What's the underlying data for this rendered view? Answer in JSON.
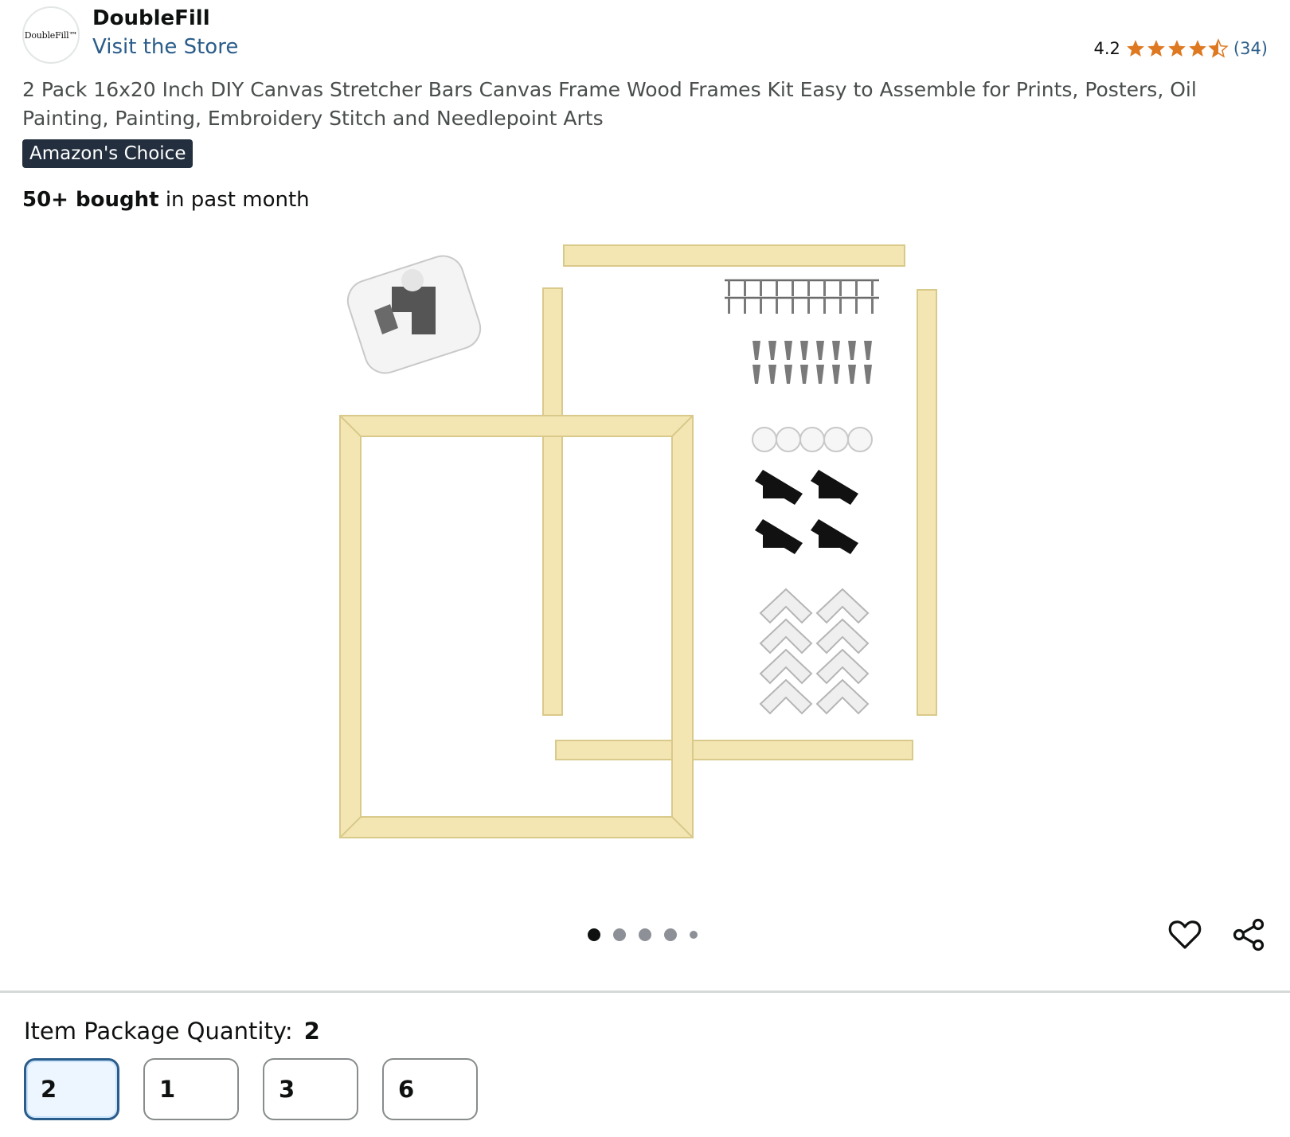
{
  "store": {
    "logo_text": "DoubleFill™",
    "brand": "DoubleFill",
    "visit_link": "Visit the Store"
  },
  "rating": {
    "value": "4.2",
    "stars": 4.2,
    "count": "(34)",
    "star_color": "#de7921"
  },
  "product": {
    "title": "2 Pack 16x20 Inch DIY Canvas Stretcher Bars Canvas Frame Wood Frames Kit Easy to Assemble for Prints, Posters, Oil Painting, Painting, Embroidery Stitch and Needlepoint Arts",
    "badge": "Amazon's Choice",
    "bought_bold": "50+ bought",
    "bought_rest": " in past month"
  },
  "carousel": {
    "total_dots": 5,
    "active_index": 0
  },
  "actions": {
    "wishlist_icon": "heart-icon",
    "share_icon": "share-icon"
  },
  "quantity": {
    "label": "Item Package Quantity:",
    "selected": "2",
    "options": [
      "2",
      "1",
      "3",
      "6"
    ]
  },
  "colors": {
    "link": "#2b5d8a",
    "badge_bg": "#232f3e",
    "wood": "#f3e6b3"
  }
}
